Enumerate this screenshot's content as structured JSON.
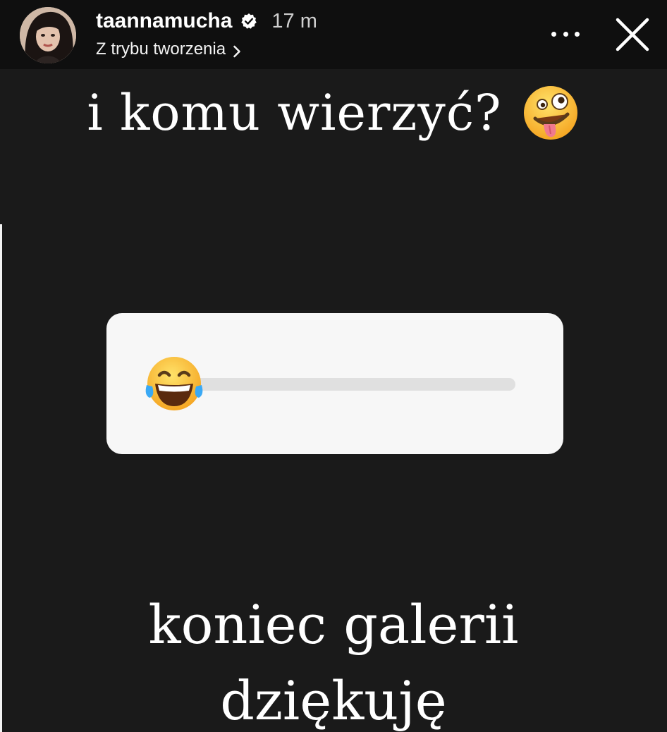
{
  "header": {
    "username": "taannamucha",
    "time": "17 m",
    "subtitle": "Z trybu tworzenia",
    "avatar_icon": "profile-photo",
    "verified_icon": "verified-badge-icon",
    "more_icon": "more-horizontal-icon",
    "close_icon": "close-icon"
  },
  "story": {
    "headline": "i komu wierzyć?",
    "headline_emoji": "zany-face",
    "slider": {
      "emoji": "face-with-tears-of-joy",
      "value": 0
    },
    "footer_line1": "koniec galerii",
    "footer_line2": "dziękuję"
  },
  "colors": {
    "background": "#1a1a1a",
    "header_background": "#0f0f0f",
    "card": "#f7f7f7",
    "track": "#e0e0e0",
    "text": "#ffffff"
  }
}
